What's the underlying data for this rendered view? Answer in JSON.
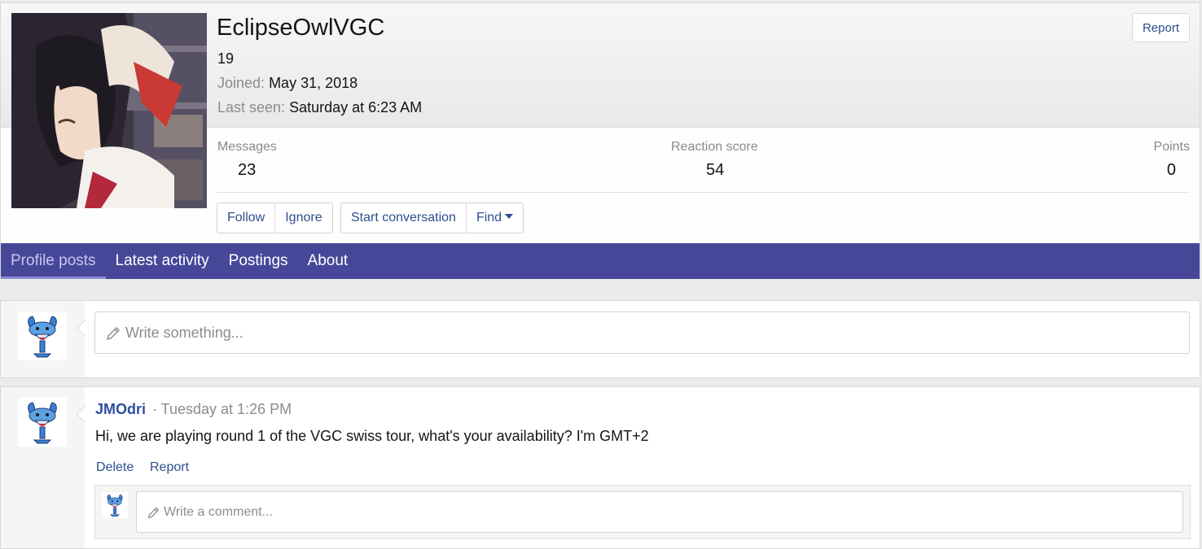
{
  "profile": {
    "username": "EclipseOwlVGC",
    "user_title": "19",
    "joined_label": "Joined:",
    "joined_value": "May 31, 2018",
    "last_seen_label": "Last seen:",
    "last_seen_value": "Saturday at 6:23 AM",
    "report_label": "Report",
    "avatar_icon": "anime-girl-avatar"
  },
  "stats": {
    "messages_label": "Messages",
    "messages_value": "23",
    "reaction_label": "Reaction score",
    "reaction_value": "54",
    "points_label": "Points",
    "points_value": "0"
  },
  "actions": {
    "follow": "Follow",
    "ignore": "Ignore",
    "start_conversation": "Start conversation",
    "find": "Find"
  },
  "tabs": [
    {
      "label": "Profile posts",
      "active": true
    },
    {
      "label": "Latest activity",
      "active": false
    },
    {
      "label": "Postings",
      "active": false
    },
    {
      "label": "About",
      "active": false
    }
  ],
  "composer": {
    "placeholder": "Write something..."
  },
  "post": {
    "author": "JMOdri",
    "separator_time": "· Tuesday at 1:26 PM",
    "text": "Hi, we are playing round 1 of the VGC swiss tour, what's your availability? I'm GMT+2",
    "delete_label": "Delete",
    "report_label": "Report",
    "comment_placeholder": "Write a comment..."
  },
  "colors": {
    "nav_bg": "#47479a",
    "link": "#2d4e8c"
  }
}
